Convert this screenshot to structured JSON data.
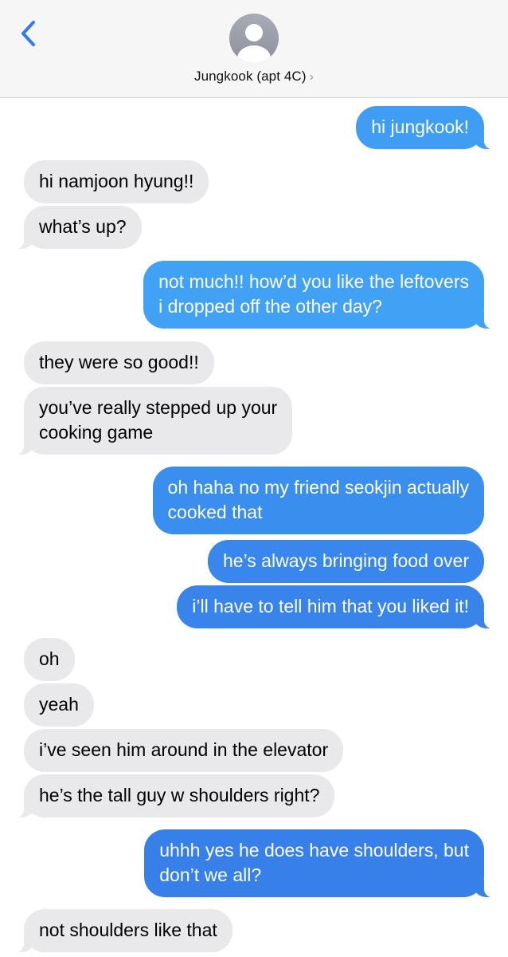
{
  "header": {
    "contact_name": "Jungkook (apt 4C)",
    "back_icon": "chevron-left-icon",
    "disclosure_icon": "chevron-right-icon",
    "avatar_icon": "person-silhouette-icon"
  },
  "colors": {
    "incoming_bubble": "#e9e9eb",
    "outgoing_bubble": "#3c89ee",
    "accent": "#3478f6"
  },
  "messages": [
    {
      "from": "me",
      "text": "hi jungkook!"
    },
    {
      "from": "them",
      "text": "hi namjoon hyung!!"
    },
    {
      "from": "them",
      "text": "what’s up?"
    },
    {
      "from": "me",
      "lines": [
        "not much!! how’d you like the leftovers",
        "i dropped off the other day?"
      ]
    },
    {
      "from": "them",
      "text": "they were so good!!"
    },
    {
      "from": "them",
      "lines": [
        "you’ve really stepped up your",
        "cooking game"
      ]
    },
    {
      "from": "me",
      "lines": [
        "oh haha no my friend seokjin actually",
        "cooked that"
      ]
    },
    {
      "from": "me",
      "text": "he’s always bringing food over"
    },
    {
      "from": "me",
      "text": "i’ll have to tell him that you liked it!"
    },
    {
      "from": "them",
      "text": "oh"
    },
    {
      "from": "them",
      "text": "yeah"
    },
    {
      "from": "them",
      "text": "i’ve seen him around in the elevator"
    },
    {
      "from": "them",
      "text": "he’s the tall guy w shoulders right?"
    },
    {
      "from": "me",
      "lines": [
        "uhhh yes he does have shoulders, but",
        "don’t we all?"
      ]
    },
    {
      "from": "them",
      "text": "not shoulders like that"
    }
  ]
}
